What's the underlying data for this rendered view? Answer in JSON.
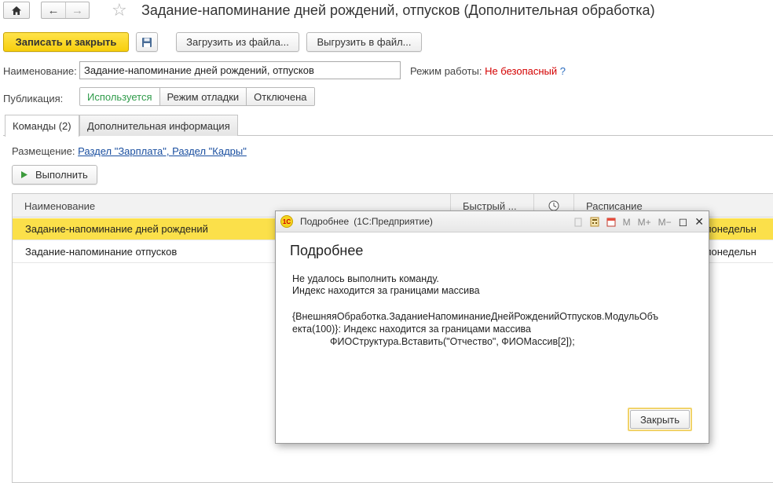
{
  "window": {
    "title": "Задание-напоминание дней рождений, отпусков (Дополнительная обработка)"
  },
  "toolbar": {
    "save_close": "Записать и закрыть",
    "load_file": "Загрузить из файла...",
    "export_file": "Выгрузить в файл..."
  },
  "form": {
    "name_label": "Наименование:",
    "name_value": "Задание-напоминание дней рождений, отпусков",
    "mode_label": "Режим работы:",
    "mode_value": "Не безопасный",
    "mode_help": "?",
    "publication_label": "Публикация:",
    "publication_options": [
      "Используется",
      "Режим отладки",
      "Отключена"
    ],
    "publication_selected": "Используется"
  },
  "tabs": [
    {
      "label": "Команды (2)",
      "active": true
    },
    {
      "label": "Дополнительная информация",
      "active": false
    }
  ],
  "placement": {
    "label": "Размещение:",
    "value": "Раздел \"Зарплата\", Раздел \"Кадры\""
  },
  "execute_label": "Выполнить",
  "table": {
    "columns": [
      "Наименование",
      "Быстрый ...",
      "",
      "Расписание"
    ],
    "rows": [
      {
        "name": "Задание-напоминание дней рождений",
        "schedule": "и [понедельн",
        "selected": true
      },
      {
        "name": "Задание-напоминание отпусков",
        "schedule": "и [понедельн",
        "selected": false
      }
    ]
  },
  "dialog": {
    "window_title": "Подробнее",
    "app_name": "(1С:Предприятие)",
    "logo_text": "1С",
    "tools": [
      "M",
      "M+",
      "M−"
    ],
    "heading": "Подробнее",
    "message_line1": "Не удалось выполнить команду.",
    "message_line2": "Индекс находится за границами массива",
    "detail_line1": "{ВнешняяОбработка.ЗаданиеНапоминаниеДнейРожденийОтпусков.МодульОбъ",
    "detail_line2": "екта(100)}: Индекс находится за границами массива",
    "detail_line3": "ФИОСтруктура.Вставить(\"Отчество\", ФИОМассив[2]);",
    "close_label": "Закрыть"
  },
  "colors": {
    "accent_yellow": "#f7cf0d",
    "selection": "#fbe04a",
    "unsafe_red": "#d40000",
    "active_green": "#2f9b4a",
    "link_blue": "#1a4fa0"
  }
}
